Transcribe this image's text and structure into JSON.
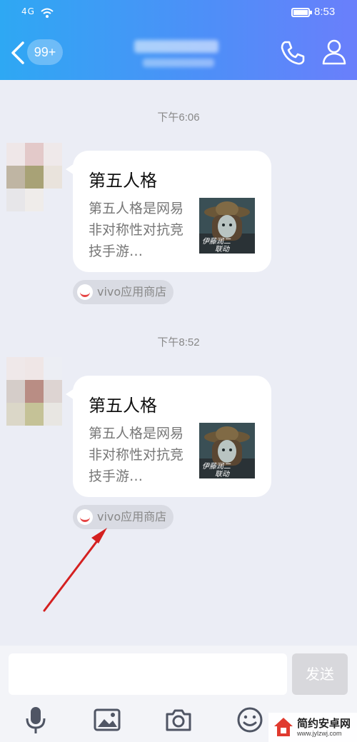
{
  "status_bar": {
    "signal": "4G",
    "time": "8:53"
  },
  "header": {
    "unread_badge": "99+"
  },
  "messages": [
    {
      "timestamp": "下午6:06",
      "card_title": "第五人格",
      "card_description": "第五人格是网易非对称性对抗竞技手游…",
      "thumbnail_text": "伊藤润二 联动",
      "source": "vivo应用商店"
    },
    {
      "timestamp": "下午8:52",
      "card_title": "第五人格",
      "card_description": "第五人格是网易非对称性对抗竞技手游…",
      "thumbnail_text": "伊藤润二 联动",
      "source": "vivo应用商店"
    }
  ],
  "input_bar": {
    "placeholder": "",
    "send_label": "发送"
  },
  "toolbar": {
    "icons": [
      "microphone-icon",
      "image-icon",
      "camera-icon",
      "emoji-icon"
    ]
  },
  "watermark": {
    "name": "简约安卓网",
    "url": "www.jylzwj.com"
  },
  "colors": {
    "header_start": "#2ea8f3",
    "header_end": "#6a7ffb",
    "background": "#ebedf5",
    "bubble": "#ffffff",
    "annotation_arrow": "#d42020"
  }
}
